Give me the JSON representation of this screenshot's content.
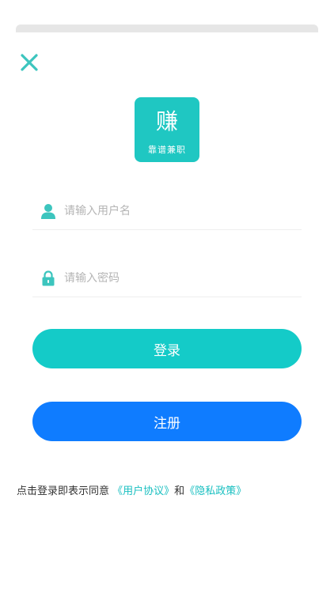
{
  "logo": {
    "main": "赚",
    "sub": "靠谱兼职"
  },
  "login_form": {
    "username_placeholder": "请输入用户名",
    "username_value": "",
    "password_placeholder": "请输入密码",
    "password_value": "",
    "login_label": "登录",
    "register_label": "注册"
  },
  "agreement": {
    "prefix": "点击登录即表示同意",
    "user_agreement": "《用户协议》",
    "conjunction": "和",
    "privacy_policy": "《隐私政策》"
  },
  "icons": {
    "close": "close-icon",
    "user": "user-icon",
    "lock": "lock-icon"
  },
  "colors": {
    "accent_teal": "#14cbc8",
    "register_blue": "#0f7cff",
    "link_teal": "#17bfc0",
    "icon_teal": "#3cc5be"
  }
}
